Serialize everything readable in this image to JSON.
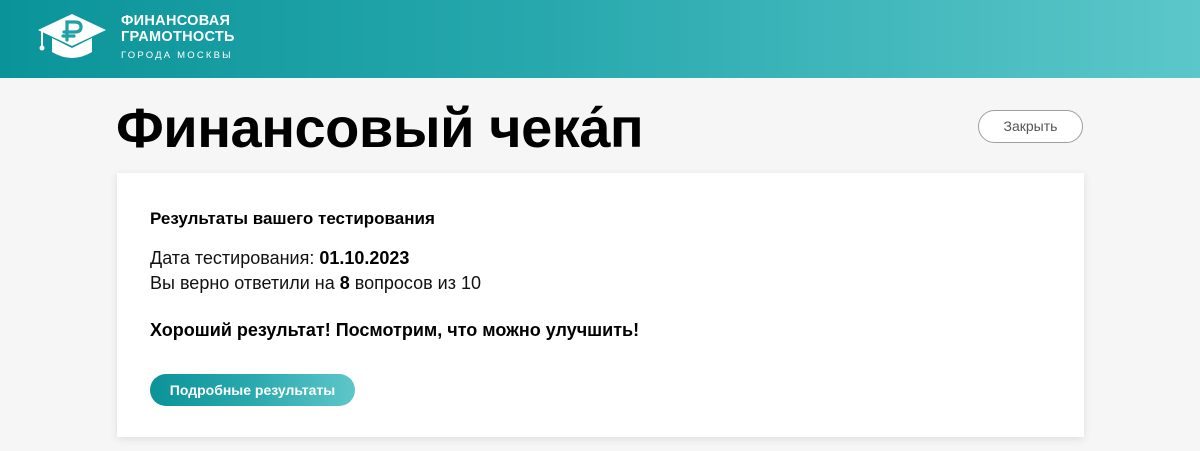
{
  "header": {
    "logo_line1": "ФИНАНСОВАЯ",
    "logo_line2": "ГРАМОТНОСТЬ",
    "logo_line3": "ГОРОДА МОСКВЫ",
    "logo_icon": "graduation-cap-ruble-icon"
  },
  "page": {
    "title": "Финансовый чека́п",
    "close_label": "Закрыть"
  },
  "results": {
    "heading": "Результаты вашего тестирования",
    "date_label": "Дата тестирования: ",
    "date_value": "01.10.2023",
    "answers_prefix": "Вы верно ответили на ",
    "correct_count": "8",
    "answers_suffix": " вопросов из 10",
    "verdict": "Хороший результат! Посмотрим, что можно улучшить!",
    "details_button": "Подробные результаты"
  },
  "colors": {
    "accent_start": "#0a9499",
    "accent_end": "#5cc7ca",
    "background": "#f6f6f6",
    "card": "#ffffff"
  }
}
